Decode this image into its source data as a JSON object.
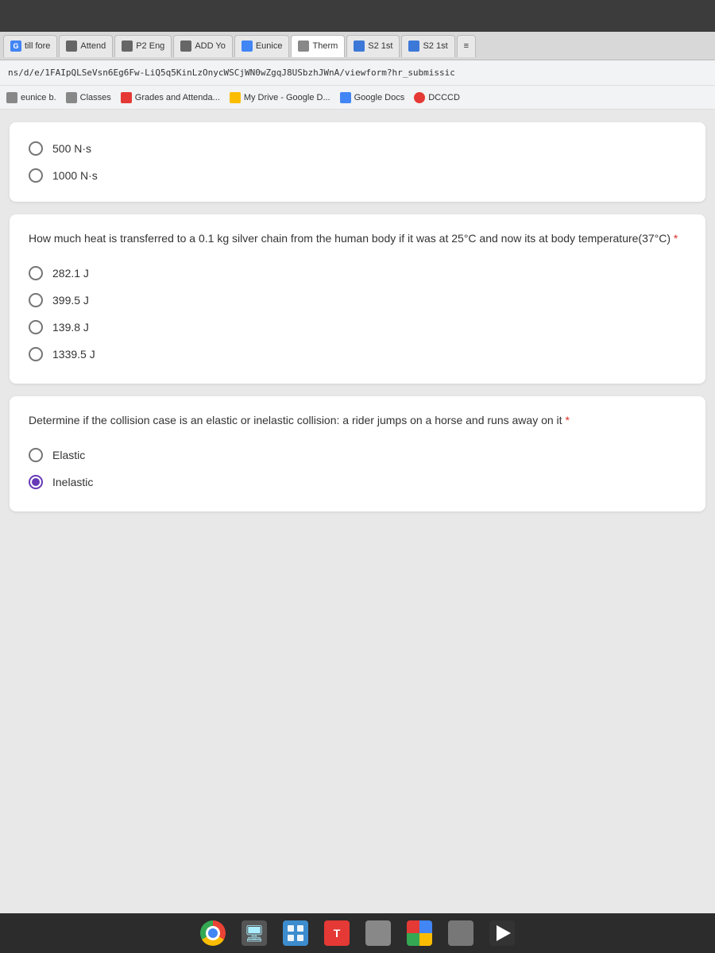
{
  "browser": {
    "tabs": [
      {
        "id": "tab-g",
        "label": "till fore",
        "icon_type": "g",
        "active": false
      },
      {
        "id": "tab-attend",
        "label": "Attend",
        "icon_type": "person",
        "active": false
      },
      {
        "id": "tab-p2eng",
        "label": "P2 Eng",
        "icon_type": "person",
        "active": false
      },
      {
        "id": "tab-add",
        "label": "ADD Yo",
        "icon_type": "person",
        "active": false
      },
      {
        "id": "tab-eunice",
        "label": "Eunice",
        "icon_type": "doc",
        "active": false
      },
      {
        "id": "tab-therm",
        "label": "Therm",
        "icon_type": "person",
        "active": true
      },
      {
        "id": "tab-s21st-1",
        "label": "S2 1st",
        "icon_type": "list",
        "active": false
      },
      {
        "id": "tab-s21st-2",
        "label": "S2 1st",
        "icon_type": "list",
        "active": false
      },
      {
        "id": "tab-more",
        "label": "≡",
        "icon_type": "none",
        "active": false
      }
    ],
    "url": "ns/d/e/1FAIpQLSeVsn6Eg6Fw-LiQ5q5KinLzOnycWSCjWN0wZgqJ8USbzhJWnA/viewform?hr_submissic"
  },
  "bookmarks": [
    {
      "label": "eunice b.",
      "icon_type": "person"
    },
    {
      "label": "Classes",
      "icon_type": "person"
    },
    {
      "label": "Grades and Attenda...",
      "icon_type": "sis"
    },
    {
      "label": "My Drive - Google D...",
      "icon_type": "drive"
    },
    {
      "label": "Google Docs",
      "icon_type": "docs"
    },
    {
      "label": "DCCCD",
      "icon_type": "dcccd"
    }
  ],
  "previous_options": [
    {
      "id": "opt-500",
      "label": "500 N·s",
      "selected": false
    },
    {
      "id": "opt-1000",
      "label": "1000 N·s",
      "selected": false
    }
  ],
  "question2": {
    "text": "How much heat is transferred to a 0.1 kg silver chain from the human body if it was at 25°C and now its at body temperature(37°C)",
    "required": true,
    "options": [
      {
        "id": "opt-282",
        "label": "282.1 J",
        "selected": false
      },
      {
        "id": "opt-399",
        "label": "399.5 J",
        "selected": false
      },
      {
        "id": "opt-139",
        "label": "139.8 J",
        "selected": false
      },
      {
        "id": "opt-1339",
        "label": "1339.5 J",
        "selected": false
      }
    ]
  },
  "question3": {
    "text": "Determine if the collision case is an elastic or inelastic collision: a rider jumps on a horse and runs away on it",
    "required": true,
    "options": [
      {
        "id": "opt-elastic",
        "label": "Elastic",
        "selected": false
      },
      {
        "id": "opt-inelastic",
        "label": "Inelastic",
        "selected": true
      }
    ]
  },
  "taskbar": {
    "items": [
      {
        "name": "chrome",
        "type": "chrome"
      },
      {
        "name": "monitor",
        "type": "monitor"
      },
      {
        "name": "files",
        "type": "files"
      },
      {
        "name": "app1",
        "type": "app1"
      },
      {
        "name": "app2",
        "type": "app2"
      },
      {
        "name": "app3",
        "type": "app3"
      },
      {
        "name": "app4",
        "type": "app4"
      },
      {
        "name": "play",
        "type": "play"
      }
    ]
  }
}
